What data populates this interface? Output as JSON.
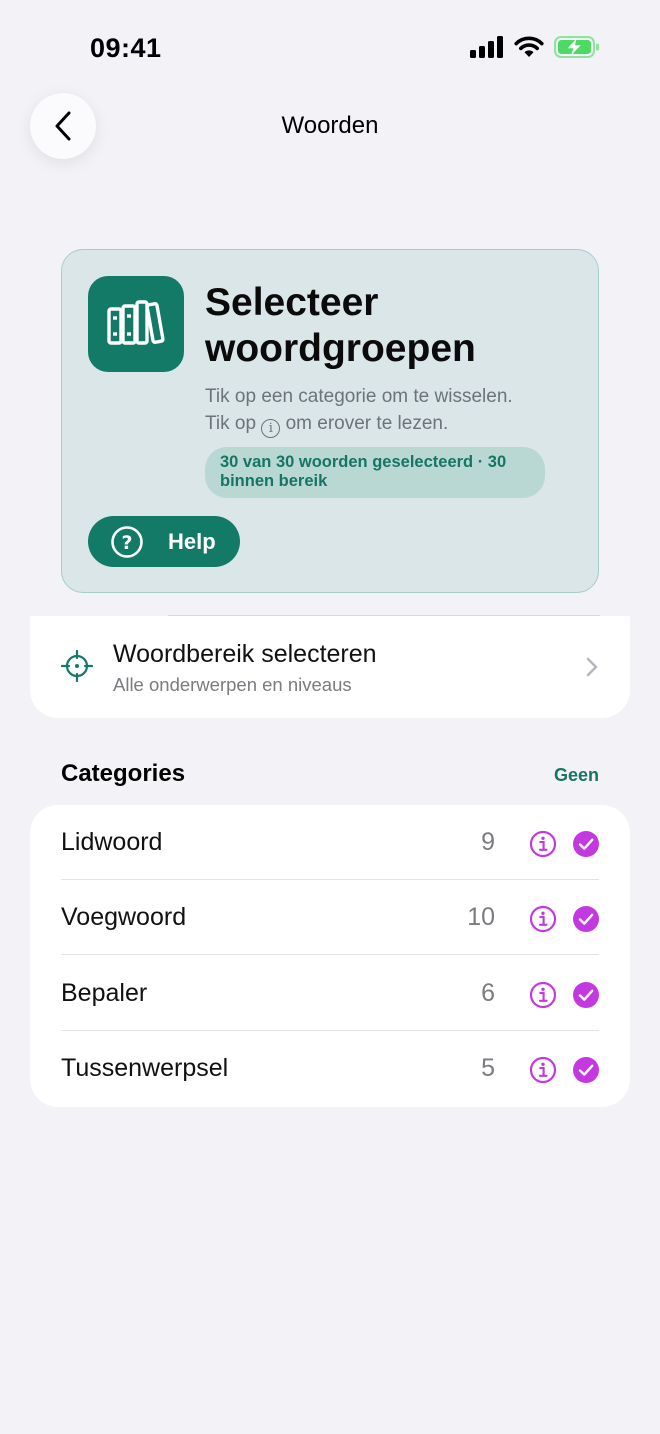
{
  "status_bar": {
    "time": "09:41",
    "icons": [
      "signal-icon",
      "wifi-icon",
      "battery-charging-icon"
    ],
    "battery_color": "#4cd964"
  },
  "nav": {
    "title": "Woorden",
    "back_icon": "chevron-left-icon"
  },
  "hero": {
    "icon": "books-icon",
    "title": "Selecteer woordgroepen",
    "subtitle_line1": "Tik op een categorie om te wisselen.",
    "subtitle_line2_prefix": "Tik op",
    "subtitle_line2_icon": "i",
    "subtitle_line2_suffix": "om erover te lezen.",
    "badge": "30 van 30 woorden geselecteerd · 30 binnen bereik",
    "help_label": "Help",
    "help_icon": "question-circle-icon",
    "help_icon_glyph": "?"
  },
  "range": {
    "icon": "crosshair-icon",
    "title": "Woordbereik selecteren",
    "subtitle": "Alle onderwerpen en niveaus",
    "chevron_icon": "chevron-right-icon"
  },
  "categories": {
    "heading": "Categories",
    "action_label": "Geen",
    "items": [
      {
        "name": "Lidwoord",
        "count": "9",
        "selected": true
      },
      {
        "name": "Voegwoord",
        "count": "10",
        "selected": true
      },
      {
        "name": "Bepaler",
        "count": "6",
        "selected": true
      },
      {
        "name": "Tussenwerpsel",
        "count": "5",
        "selected": true
      }
    ]
  },
  "colors": {
    "accent_green": "#147a68",
    "accent_purple": "#c438e0",
    "background": "#f2f2f7",
    "hero_background": "#dae6e8"
  }
}
